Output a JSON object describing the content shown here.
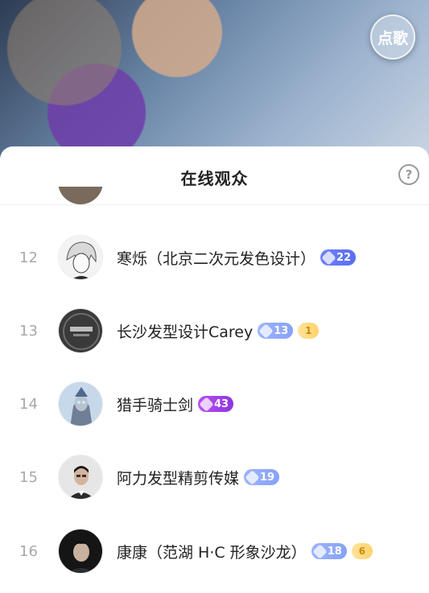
{
  "live": {
    "song_button_label": "点歌"
  },
  "panel": {
    "title": "在线观众",
    "help_label": "?"
  },
  "viewers": [
    {
      "rank": "12",
      "name": "寒烁（北京二次元发色设计）",
      "badge_level": "22",
      "badge_style": "blue",
      "extra_badge": "",
      "avatar": "anime-boy-avatar"
    },
    {
      "rank": "13",
      "name": "长沙发型设计Carey",
      "badge_level": "13",
      "badge_style": "lightblue",
      "extra_badge": "1",
      "avatar": "salon-avatar"
    },
    {
      "rank": "14",
      "name": "猎手骑士剑",
      "badge_level": "43",
      "badge_style": "purple",
      "extra_badge": "",
      "avatar": "ultraman-avatar"
    },
    {
      "rank": "15",
      "name": "阿力发型精剪传媒",
      "badge_level": "19",
      "badge_style": "lightblue",
      "extra_badge": "",
      "avatar": "man-suit-avatar"
    },
    {
      "rank": "16",
      "name": "康康（范湖 H·C 形象沙龙）",
      "badge_level": "18",
      "badge_style": "lightblue",
      "extra_badge": "6",
      "avatar": "dark-portrait-avatar"
    }
  ],
  "colors": {
    "rank_text": "#a8a8a8",
    "name_text": "#222222",
    "badge_blue": "#5a6df2",
    "badge_lightblue": "#88a2f7",
    "badge_purple": "#8e35e0",
    "badge_gold": "#ffd36b"
  }
}
